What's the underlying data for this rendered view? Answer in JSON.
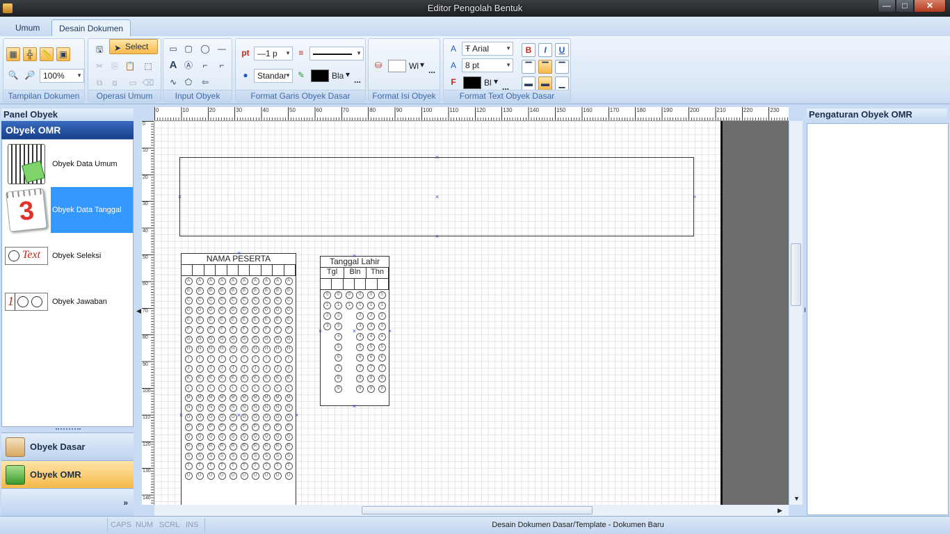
{
  "window": {
    "title": "Editor Pengolah Bentuk",
    "minimize": "—",
    "maximize": "□",
    "close": "✕"
  },
  "tabs": [
    {
      "label": "Umum"
    },
    {
      "label": "Desain Dokumen"
    }
  ],
  "ribbon": {
    "groups": {
      "tampilan": "Tampilan Dokumen",
      "operasi": "Operasi Umum",
      "input": "Input Obyek",
      "format_garis": "Format Garis Obyek Dasar",
      "format_isi": "Format Isi Obyek",
      "format_text": "Format Text Obyek Dasar"
    },
    "zoom": "100%",
    "select_label": "Select",
    "line_width": "1 p",
    "line_style": "Standar",
    "line_color": "Bla",
    "fill_color": "Wl",
    "font_name": "Arial",
    "font_size": "8 pt",
    "font_color": "Bl",
    "bold": "B",
    "italic": "I",
    "underline": "U",
    "more": "..."
  },
  "left_panel": {
    "title": "Panel Obyek",
    "section": "Obyek OMR",
    "items": [
      {
        "label": "Obyek Data Umum"
      },
      {
        "label": "Obyek Data Tanggal"
      },
      {
        "label": "Obyek Seleksi"
      },
      {
        "label": "Obyek Jawaban"
      }
    ],
    "seleksi_icon_text": "Text",
    "jawaban_icon_text": "1",
    "calendar_number": "3",
    "nav": [
      {
        "label": "Obyek Dasar"
      },
      {
        "label": "Obyek OMR"
      }
    ],
    "expand": "»"
  },
  "canvas": {
    "name_block_title": "NAMA PESERTA",
    "date_block_title": "Tanggal Lahir",
    "date_cols": [
      "Tgl",
      "Bln",
      "Thn"
    ],
    "hruler_labels": [
      "0",
      "10",
      "20",
      "30",
      "40",
      "50",
      "60",
      "70",
      "80",
      "90",
      "100",
      "110",
      "120",
      "130",
      "140",
      "150",
      "160",
      "170",
      "180",
      "190",
      "200",
      "210",
      "220",
      "230"
    ],
    "vruler_labels": [
      "0",
      "10",
      "20",
      "30",
      "40",
      "50",
      "60",
      "70",
      "80",
      "90",
      "100",
      "110",
      "120",
      "130",
      "140"
    ]
  },
  "right_panel": {
    "title": "Pengaturan Obyek OMR"
  },
  "status": {
    "caps": "CAPS",
    "num": "NUM",
    "scrl": "SCRL",
    "ins": "INS",
    "message": "Desain Dokumen Dasar/Template - Dokumen Baru"
  },
  "colors": {
    "accent": "#3399ff",
    "omr_header": "#1f4e9c",
    "nav_active": "#f7b849"
  }
}
